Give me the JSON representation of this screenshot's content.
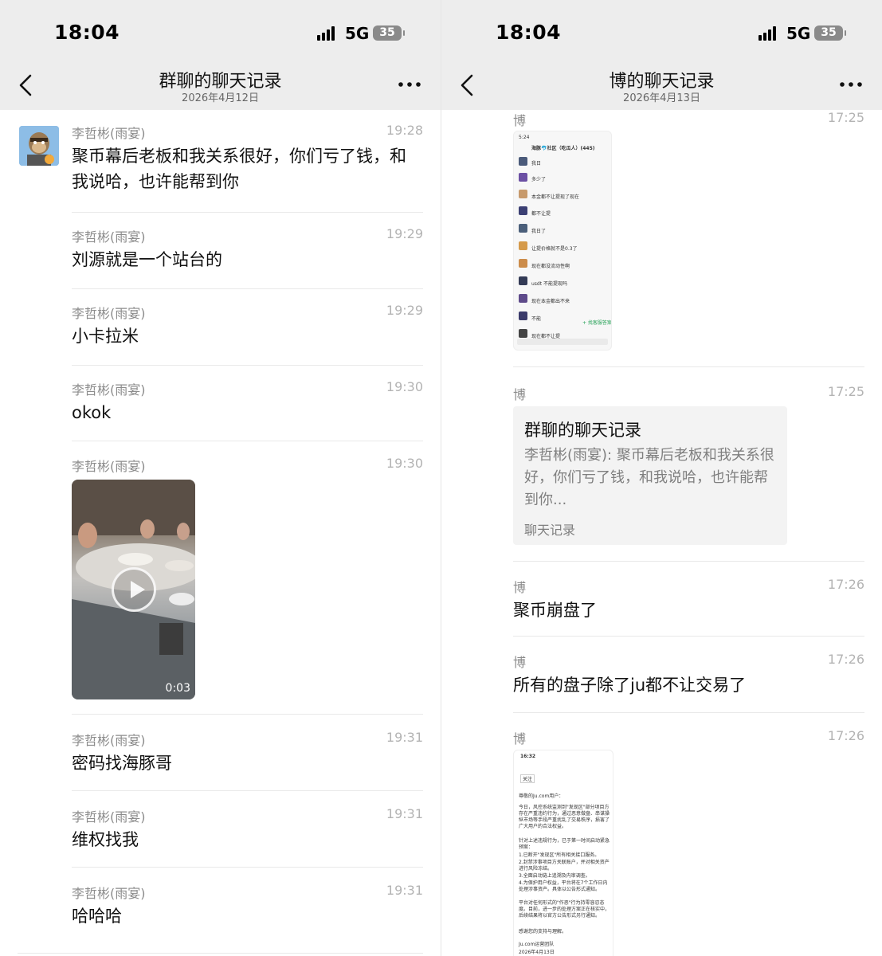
{
  "status_bar": {
    "time": "18:04",
    "network": "5G",
    "battery": "35"
  },
  "left_panel": {
    "title": "群聊的聊天记录",
    "date": "2026年4月12日",
    "messages": [
      {
        "sender": "李哲彬(雨宴)",
        "time": "19:28",
        "text": "聚币幕后老板和我关系很好，你们亏了钱，和我说哈，也许能帮到你"
      },
      {
        "sender": "李哲彬(雨宴)",
        "time": "19:29",
        "text": "刘源就是一个站台的"
      },
      {
        "sender": "李哲彬(雨宴)",
        "time": "19:29",
        "text": "小卡拉米"
      },
      {
        "sender": "李哲彬(雨宴)",
        "time": "19:30",
        "text": "okok"
      },
      {
        "sender": "李哲彬(雨宴)",
        "time": "19:30",
        "video_duration": "0:03"
      },
      {
        "sender": "李哲彬(雨宴)",
        "time": "19:31",
        "text": "密码找海豚哥"
      },
      {
        "sender": "李哲彬(雨宴)",
        "time": "19:31",
        "text": "维权找我"
      },
      {
        "sender": "李哲彬(雨宴)",
        "time": "19:31",
        "text": "哈哈哈"
      }
    ]
  },
  "right_panel": {
    "title": "博的聊天记录",
    "date": "2026年4月13日",
    "messages": [
      {
        "sender": "博",
        "time": "17:25"
      },
      {
        "sender": "博",
        "time": "17:25",
        "card": {
          "title": "群聊的聊天记录",
          "body": "李哲彬(雨宴): 聚币幕后老板和我关系很好，你们亏了钱，和我说哈，也许能帮到你...",
          "footer": "聊天记录"
        }
      },
      {
        "sender": "博",
        "time": "17:26",
        "text": "聚币崩盘了"
      },
      {
        "sender": "博",
        "time": "17:26",
        "text": "所有的盘子除了ju都不让交易了"
      },
      {
        "sender": "博",
        "time": "17:26"
      }
    ],
    "screenshot1": {
      "time": "5:24",
      "title": "海豚🐬社区（吃瓜人）(445)",
      "lines": [
        "我日",
        "多少了",
        "本金都不让提现了现在",
        "都不让提",
        "我日了",
        "让提价格就不是0.3了",
        "现在都没流动性啊",
        "usdt 不能提现吗",
        "现在本金都出不来",
        "不能",
        "现在都不让提"
      ],
      "side_button": "+ 找客服答案"
    },
    "screenshot2": {
      "time": "16:32",
      "tab": "关注",
      "greeting": "尊敬的Ju.com用户：",
      "paragraphs": [
        "今日，风控系统监测到\"发现区\"部分项目方存在严重违约行为，通过恶意做盘、串谋操纵市场等手段严重扰乱了交易秩序，损害了广大用户的合法权益。",
        "针对上述违规行为，已于第一时间启动紧急预案：",
        "1.已断开\"发现区\"所有相关接口服务。",
        "2.封禁涉事项目方关联账户，并对相关资产进行风险冻结。",
        "3.全面启动链上追溯及内审调查。",
        "4.为保护用户权益，平台将在7个工作日内处理涉事资产。具体以公告形式通知。",
        "平台对任何形式的\"作恶\"行为持零容忍态度。目前，进一步的处理方案正在核实中，后续结果将以官方公告形式另行通知。",
        "感谢您的支持与理解。",
        "Ju.com运营团队",
        "2026年4月13日"
      ]
    }
  }
}
